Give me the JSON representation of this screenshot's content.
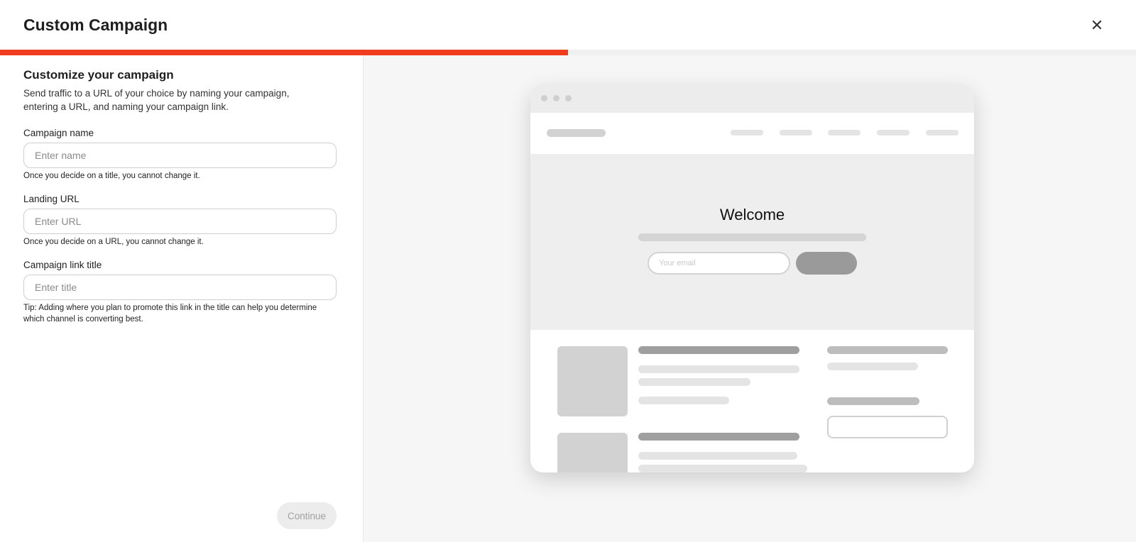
{
  "modal": {
    "title": "Custom Campaign",
    "close_icon": "close-icon",
    "progress_fraction": 0.5,
    "accent_color": "#f03c1f"
  },
  "form": {
    "heading": "Customize your campaign",
    "description": "Send traffic to a URL of your choice by naming your campaign, entering a URL, and naming your campaign link.",
    "fields": [
      {
        "label": "Campaign name",
        "placeholder": "Enter name",
        "value": "",
        "help": "Once you decide on a title, you cannot change it."
      },
      {
        "label": "Landing URL",
        "placeholder": "Enter URL",
        "value": "",
        "help": "Once you decide on a URL, you cannot change it."
      },
      {
        "label": "Campaign link title",
        "placeholder": "Enter title",
        "value": "",
        "help": "Tip: Adding where you plan to promote this link in the title can help you determine which channel is converting best."
      }
    ],
    "continue_label": "Continue"
  },
  "preview": {
    "hero_title": "Welcome",
    "email_placeholder": "Your email"
  }
}
